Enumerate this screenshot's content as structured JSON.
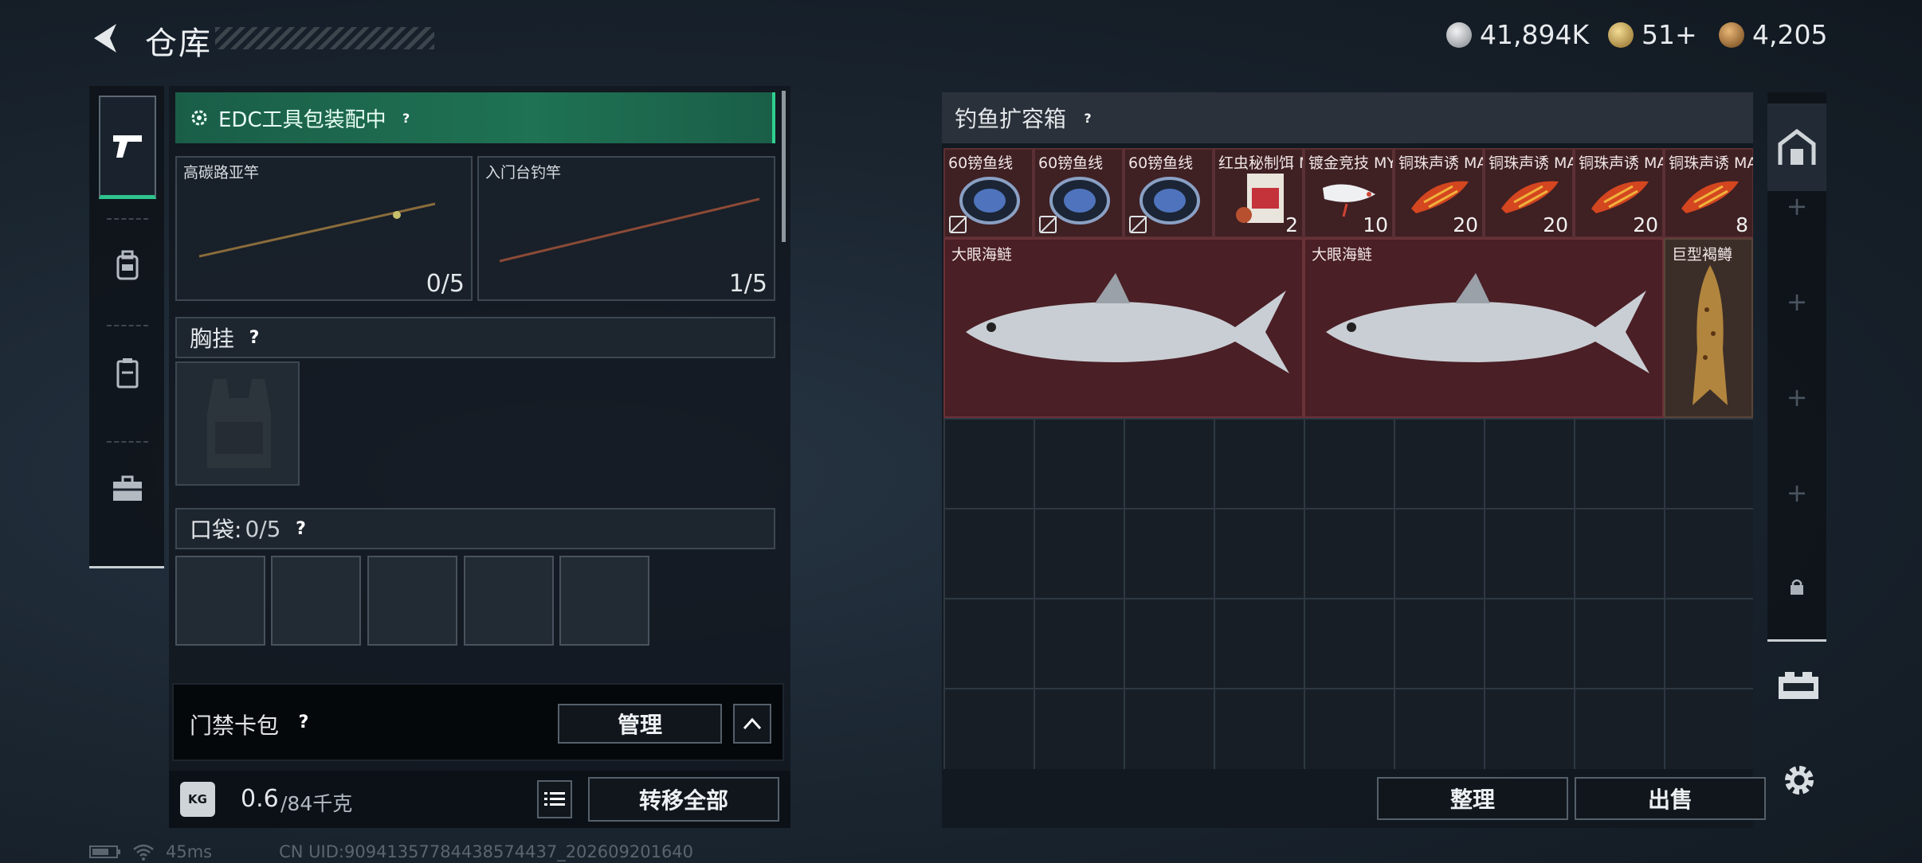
{
  "header": {
    "title": "仓库",
    "currencies": [
      {
        "value": "41,894K",
        "color": "#c9ced3"
      },
      {
        "value": "51+",
        "color": "#c8a34f"
      },
      {
        "value": "4,205",
        "color": "#b9843c"
      }
    ]
  },
  "left": {
    "edc_banner": "EDC工具包装配中",
    "rods": [
      {
        "name": "高碳路亚竿",
        "count": "0/5"
      },
      {
        "name": "入门台钓竿",
        "count": "1/5"
      }
    ],
    "chest_rig": {
      "label": "胸挂"
    },
    "pockets": {
      "label": "口袋:",
      "count": "0/5"
    },
    "keycard": {
      "label": "门禁卡包",
      "manage": "管理"
    },
    "weight": {
      "value": "0.6",
      "max": "/84千克"
    },
    "transfer_all": "转移全部"
  },
  "right": {
    "title": "钓鱼扩容箱",
    "items": [
      {
        "name": "60镑鱼线",
        "count": "",
        "kind": "line"
      },
      {
        "name": "60镑鱼线",
        "count": "",
        "kind": "line"
      },
      {
        "name": "60镑鱼线",
        "count": "",
        "kind": "line"
      },
      {
        "name": "红虫秘制饵 MY",
        "count": "2",
        "kind": "bait"
      },
      {
        "name": "镀金竞技 MYT",
        "count": "10",
        "kind": "lure-white"
      },
      {
        "name": "铜珠声诱 MAS",
        "count": "20",
        "kind": "lure-red"
      },
      {
        "name": "铜珠声诱 MAS",
        "count": "20",
        "kind": "lure-red"
      },
      {
        "name": "铜珠声诱 MAS",
        "count": "20",
        "kind": "lure-red"
      },
      {
        "name": "铜珠声诱 MAS",
        "count": "8",
        "kind": "lure-red"
      }
    ],
    "fish": [
      {
        "name": "大眼海鲢"
      },
      {
        "name": "大眼海鲢"
      },
      {
        "name": "巨型褐鳟"
      }
    ],
    "sort": "整理",
    "sell": "出售"
  },
  "status": {
    "ping": "45ms",
    "uid": "CN UID:90941357784438574437_202609201640"
  }
}
